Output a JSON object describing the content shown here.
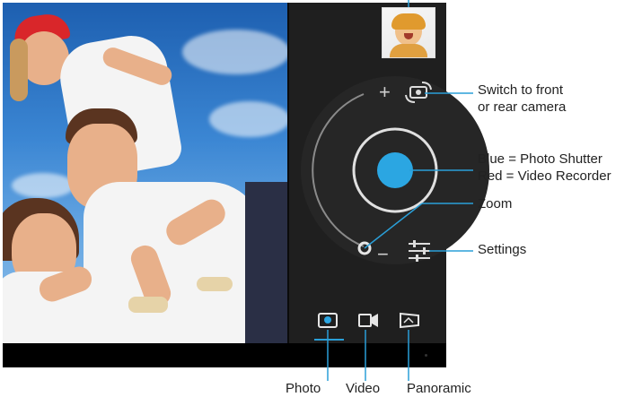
{
  "callouts": {
    "switch_camera_line1": "Switch to front",
    "switch_camera_line2": "or rear camera",
    "shutter_line1": "Blue = Photo Shutter",
    "shutter_line2": "Red = Video Recorder",
    "zoom": "Zoom",
    "settings": "Settings",
    "photo": "Photo",
    "video": "Video",
    "panoramic": "Panoramic"
  },
  "controls": {
    "zoom_in_glyph": "+",
    "zoom_out_glyph": "−",
    "active_mode": "Photo"
  },
  "colors": {
    "accent": "#2a9fd8",
    "shutter": "#2ba6e2",
    "panel": "#1f1f1f"
  },
  "icons": [
    "switch-camera-icon",
    "shutter-button",
    "zoom-slider-knob",
    "settings-icon",
    "photo-mode-icon",
    "video-mode-icon",
    "panorama-mode-icon",
    "thumbnail"
  ]
}
